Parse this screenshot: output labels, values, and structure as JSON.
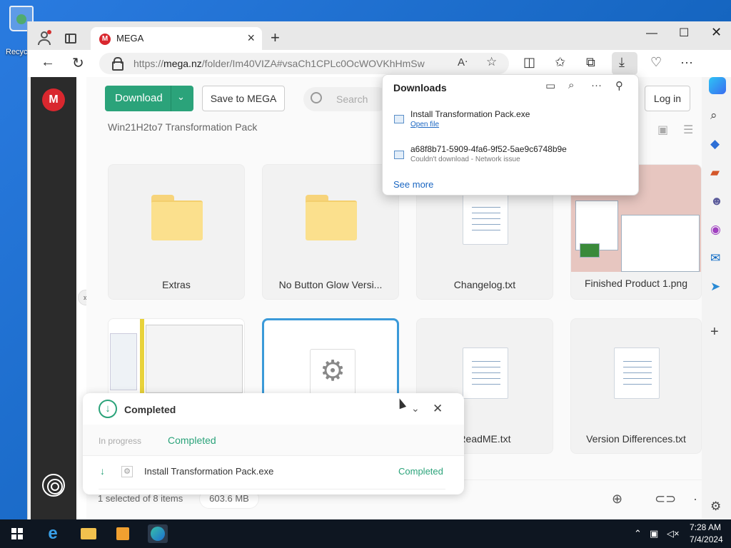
{
  "desktop": {
    "recycle_label": "Recyc"
  },
  "browser": {
    "tab_title": "MEGA",
    "url_prefix": "https://",
    "url_host": "mega.nz",
    "url_path": "/folder/Im40VIZA#vsaCh1CPLc0OcWOVKhHmSw"
  },
  "mega": {
    "download_label": "Download",
    "save_label": "Save to MEGA",
    "search_placeholder": "Search",
    "login_label": "Log in",
    "folder_title": "Win21H2to7 Transformation Pack",
    "tiles": [
      {
        "name": "Extras"
      },
      {
        "name": "No Button Glow Versi..."
      },
      {
        "name": "Changelog.txt"
      },
      {
        "name": "Finished Product 1.png"
      },
      {
        "name": ""
      },
      {
        "name": ""
      },
      {
        "name": "ReadME.txt"
      },
      {
        "name": "Version Differences.txt"
      }
    ],
    "status_selected": "1 selected of 8 items",
    "status_size": "603.6 MB"
  },
  "downloads_popup": {
    "title": "Downloads",
    "items": [
      {
        "name": "Install Transformation Pack.exe",
        "link": "Open file"
      },
      {
        "name": "a68f8b71-5909-4fa6-9f52-5ae9c6748b9e",
        "status": "Couldn't download - Network issue"
      }
    ],
    "see_more": "See more"
  },
  "transfer_panel": {
    "title": "Completed",
    "tabs": [
      "In progress",
      "Completed"
    ],
    "row": {
      "name": "Install Transformation Pack.exe",
      "status": "Completed"
    }
  },
  "taskbar": {
    "time": "7:28 AM",
    "date": "7/4/2024"
  }
}
